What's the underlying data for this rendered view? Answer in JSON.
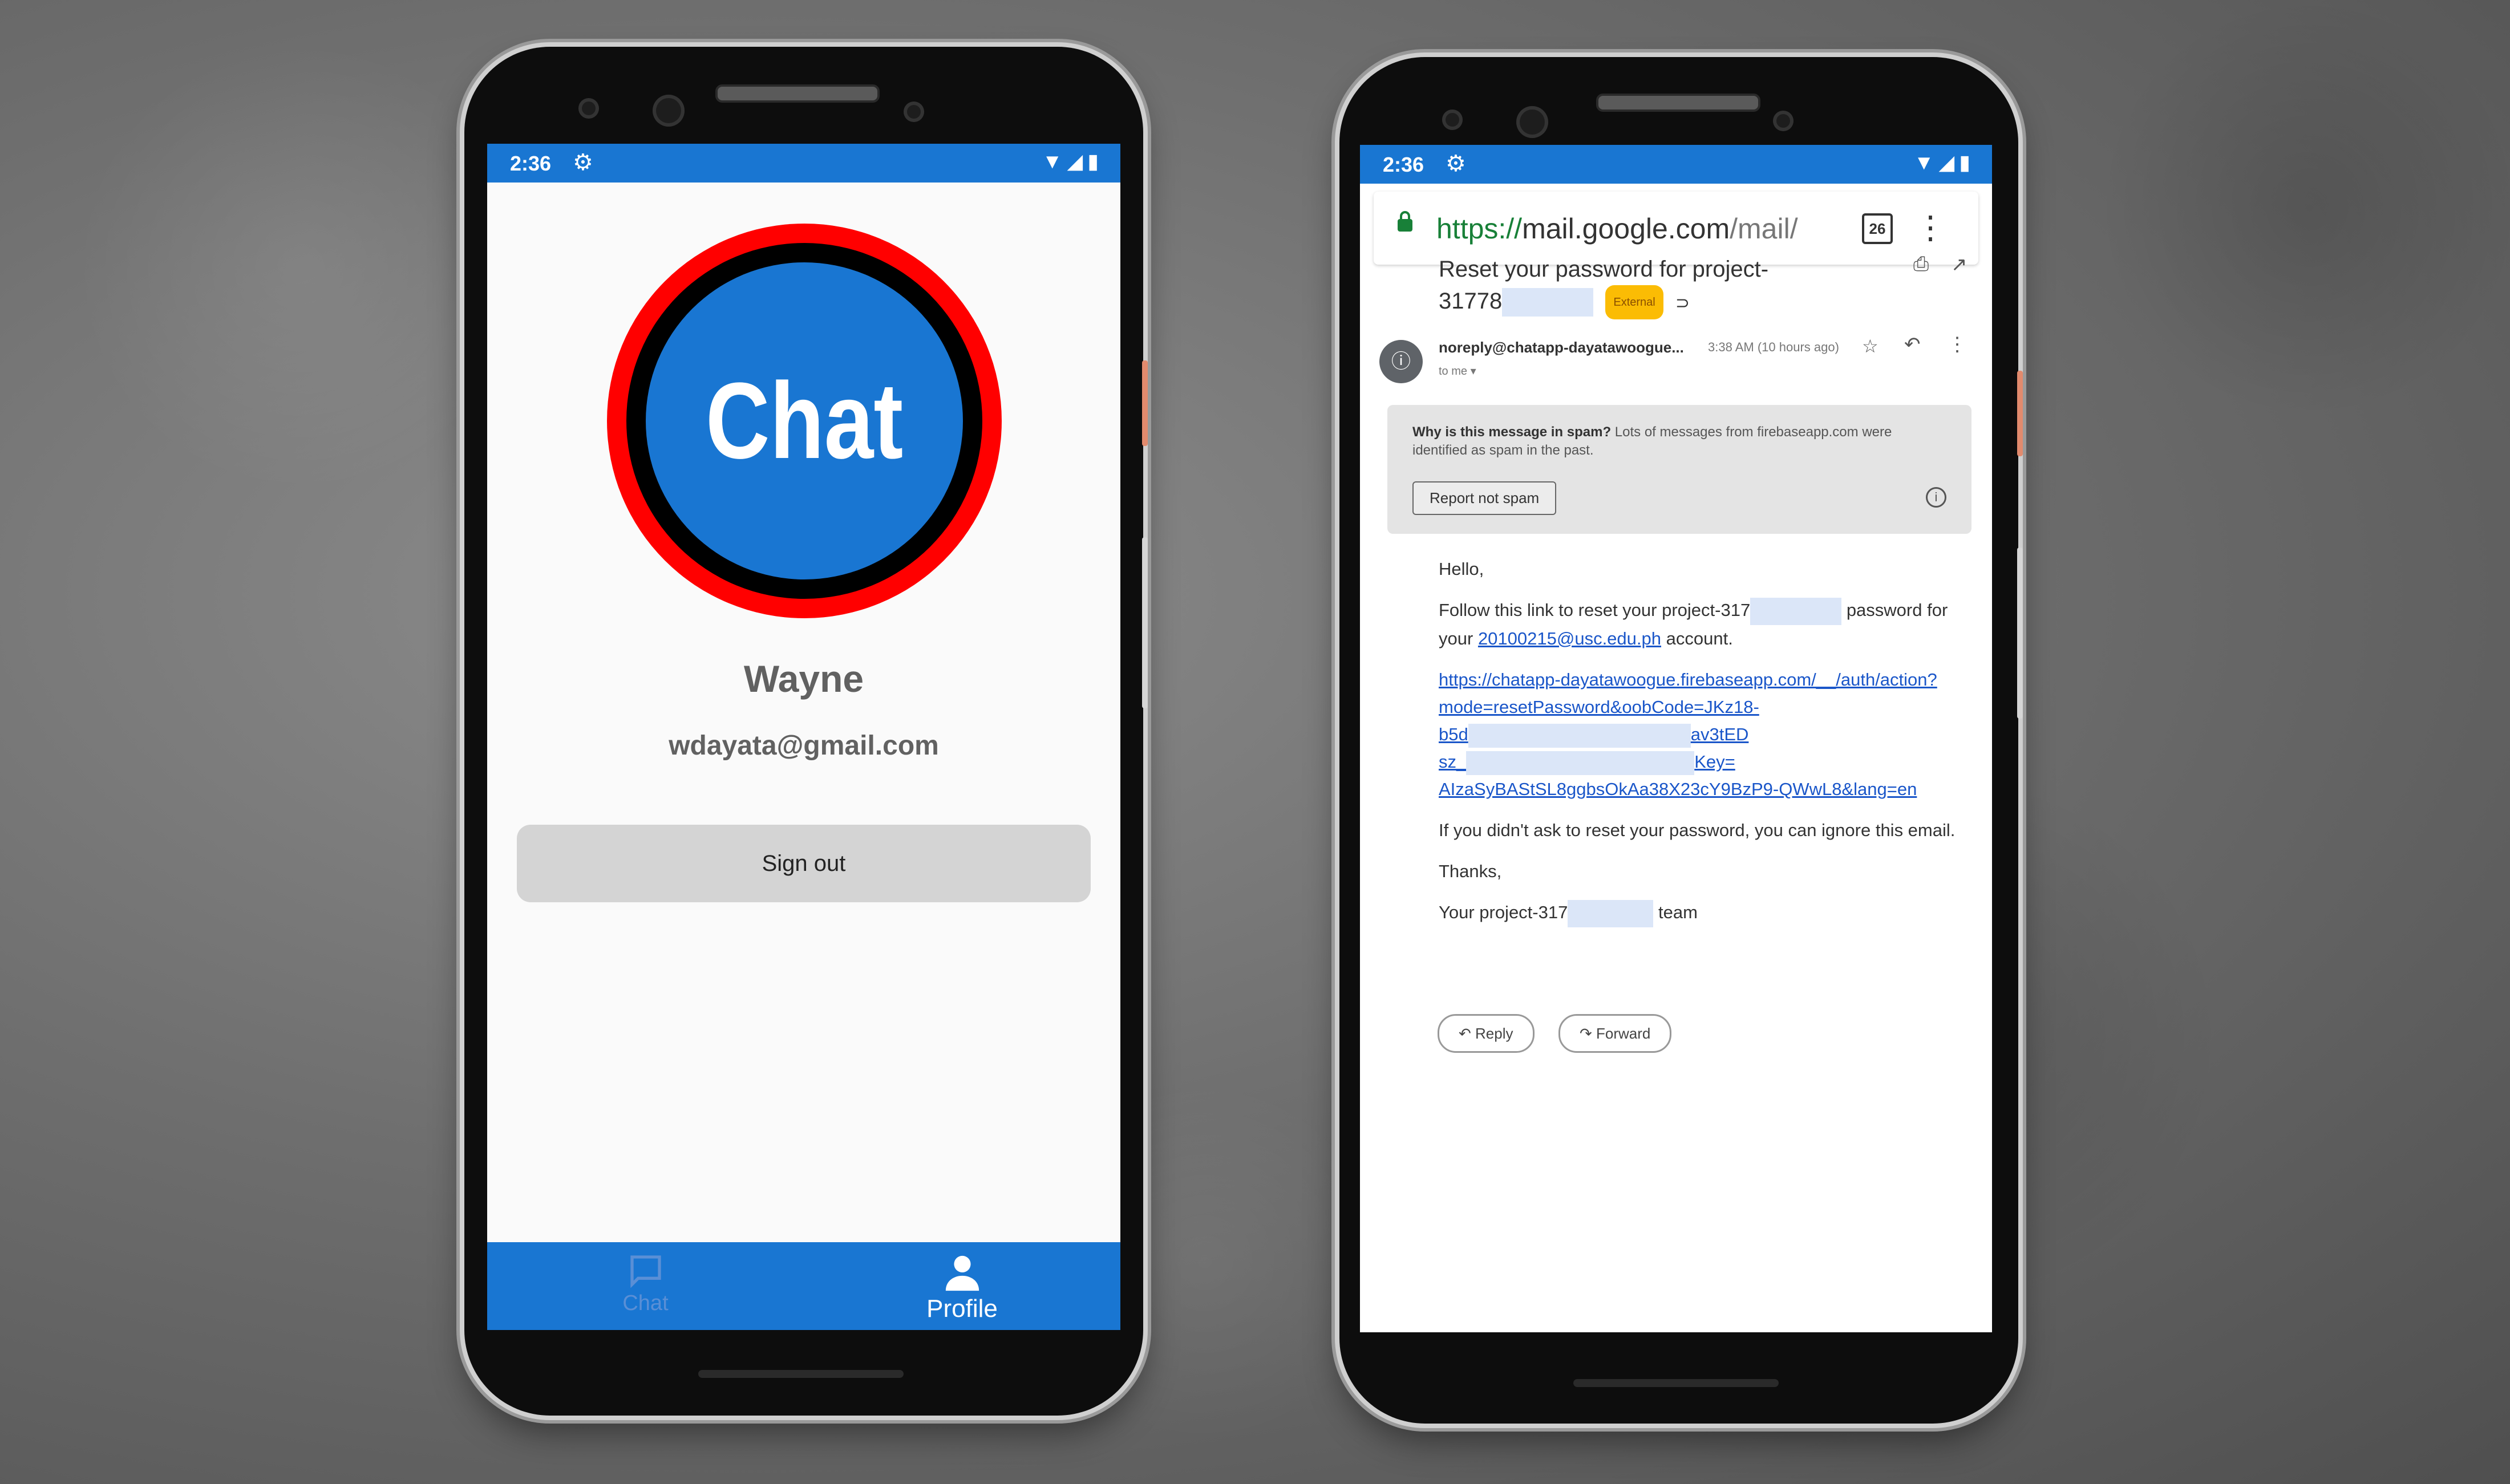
{
  "left_phone": {
    "status": {
      "time": "2:36",
      "gear_icon": "gear-icon",
      "wifi_icon": "wifi-icon",
      "signal_icon": "signal-icon",
      "battery_icon": "battery-icon"
    },
    "logo_text": "Chat",
    "profile": {
      "name": "Wayne",
      "email": "wdayata@gmail.com",
      "signout_label": "Sign out"
    },
    "bottom_nav": [
      {
        "label": "Chat",
        "icon": "chat-bubble-icon",
        "active": false
      },
      {
        "label": "Profile",
        "icon": "person-icon",
        "active": true
      }
    ],
    "colors": {
      "primary": "#1976d2",
      "logo_ring": "#ff0000"
    }
  },
  "right_phone": {
    "status": {
      "time": "2:36"
    },
    "browser": {
      "url_scheme": "https://",
      "url_host": "mail.google.com",
      "url_path": "/mail/",
      "tab_count": "26",
      "menu_icon": "kebab-menu-icon"
    },
    "email": {
      "subject_line1": "Reset your password for project-",
      "subject_line2": "31778",
      "badge": "External",
      "sender": "noreply@chatapp-dayatawoogue...",
      "time": "3:38 AM (10 hours ago)",
      "to": "to me",
      "spam_title": "Why is this message in spam?",
      "spam_text": "Lots of messages from firebaseapp.com were identified as spam in the past.",
      "report_button": "Report not spam",
      "greeting": "Hello,",
      "follow_prefix": "Follow this link to reset your project-317",
      "follow_suffix": "password for",
      "your": "your",
      "account_email": "20100215@usc.edu.ph",
      "account": "account.",
      "link_l1": "https://chatapp-dayatawoogue.firebaseapp.com/__/auth/action?",
      "link_l2": "mode=resetPassword&oobCode=JKz18-",
      "link_l3a": "b5d",
      "link_l3b": "av3tED",
      "link_l4a": "sz_",
      "link_l4b": "Key=",
      "link_l5": "AIzaSyBAStSL8ggbsOkAa38X23cY9BzP9-QWwL8&lang=en",
      "ignore": "If you didn't ask to reset your password, you can ignore this email.",
      "thanks": "Thanks,",
      "team_prefix": "Your project-317",
      "team_suffix": "team",
      "reply": "Reply",
      "forward": "Forward"
    }
  }
}
